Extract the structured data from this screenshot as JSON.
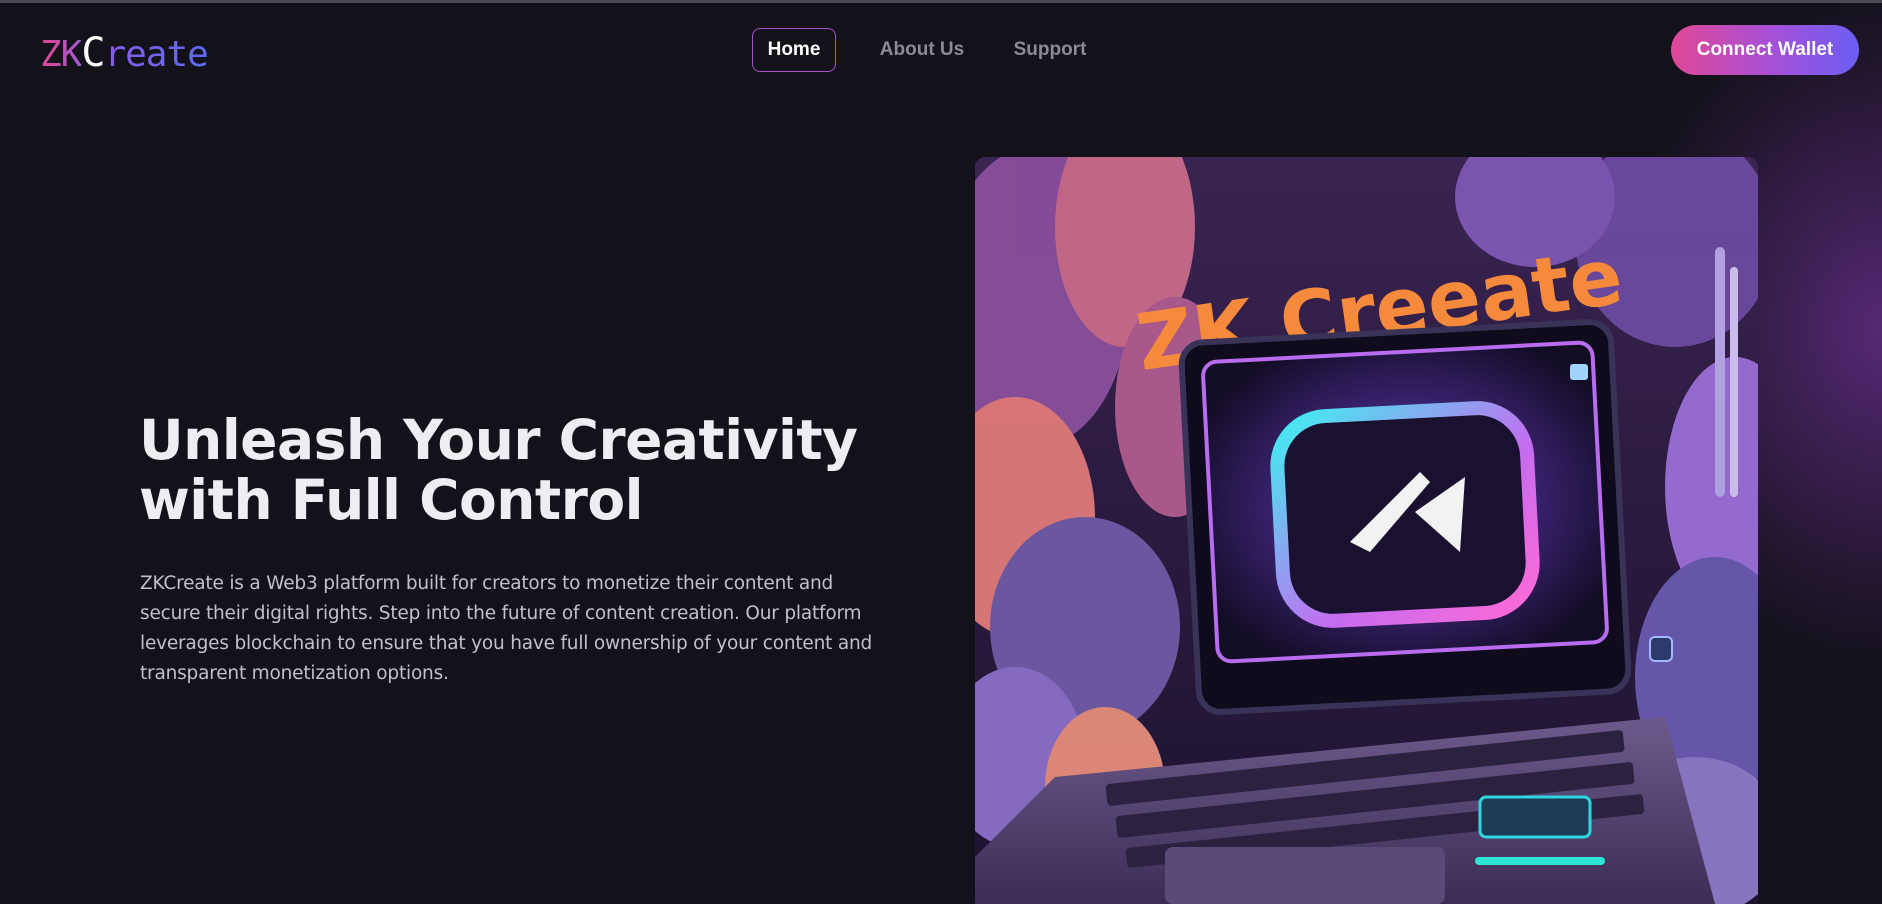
{
  "header": {
    "logo": {
      "zk": "ZK",
      "c": "C",
      "rest": "reate"
    },
    "nav": [
      {
        "label": "Home",
        "active": true
      },
      {
        "label": "About Us",
        "active": false
      },
      {
        "label": "Support",
        "active": false
      }
    ],
    "connect_label": "Connect Wallet"
  },
  "hero": {
    "title_line1": "Unleash Your Creativity",
    "title_line2": "with Full Control",
    "description": "ZKCreate is a Web3 platform built for creators to monetize their content and secure their digital rights. Step into the future of content creation. Our platform leverages blockchain to ensure that you have full ownership of your content and transparent monetization options.",
    "image": {
      "headline": "ZK Creeate"
    }
  },
  "colors": {
    "background": "#13111a",
    "accent_pink": "#e04896",
    "accent_purple": "#a352c7",
    "accent_blue": "#6b5ef4",
    "image_title_orange": "#f58a3c"
  }
}
